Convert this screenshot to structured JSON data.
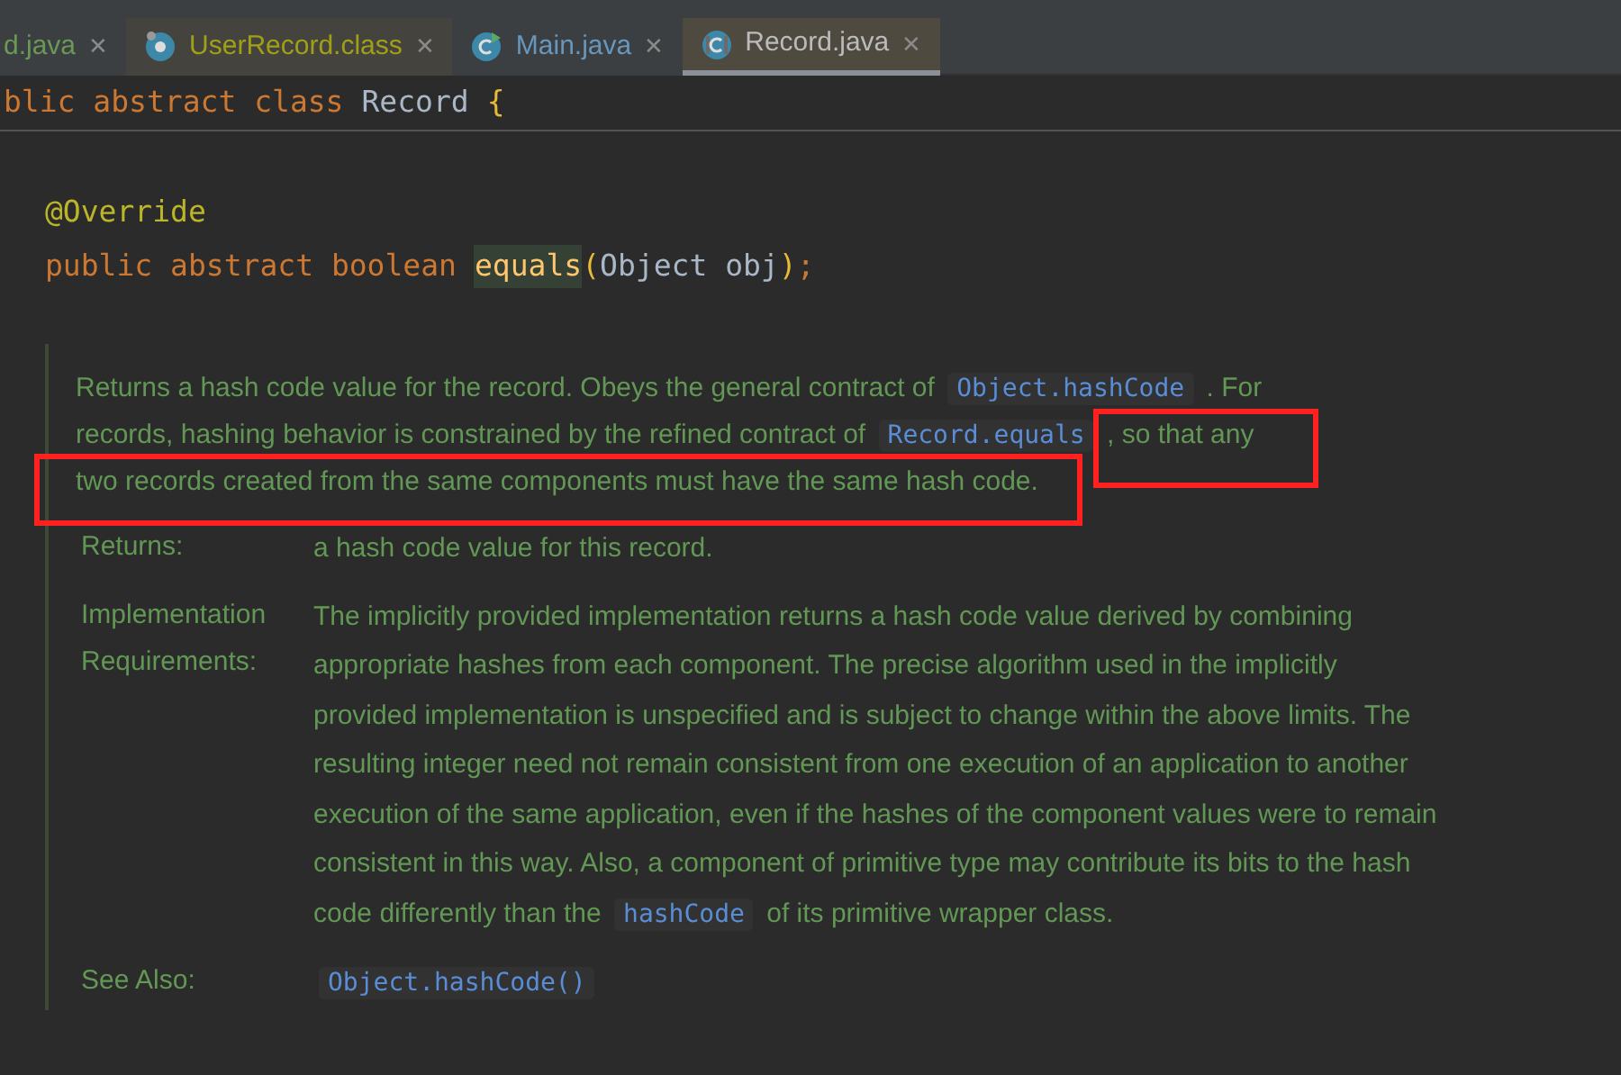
{
  "tabs": [
    {
      "label": "d.java",
      "kind": "plain",
      "close": "✕",
      "selected": false,
      "color": "#6a9955"
    },
    {
      "label": "UserRecord.class",
      "kind": "record",
      "close": "✕",
      "selected": false,
      "color": "#a0a018"
    },
    {
      "label": "Main.java",
      "kind": "runnable",
      "close": "✕",
      "selected": false,
      "color": "#6897bb"
    },
    {
      "label": "Record.java",
      "kind": "abstract",
      "close": "✕",
      "selected": true,
      "color": "#bbbbbb"
    }
  ],
  "sticky_header": [
    {
      "kind": "keyword",
      "text": "blic abstract class"
    },
    {
      "kind": "name",
      "text": "Record"
    },
    {
      "kind": "brace",
      "text": "{"
    }
  ],
  "code_lines": [
    [
      {
        "kind": "annotation",
        "text": "@Override"
      }
    ],
    [
      {
        "kind": "keyword",
        "text": "public abstract boolean"
      },
      {
        "kind": "method",
        "text": "equals"
      },
      {
        "kind": "paren",
        "text": "("
      },
      {
        "kind": "plain",
        "text": "Object obj"
      },
      {
        "kind": "paren",
        "text": ")"
      },
      {
        "kind": "keyword",
        "text": ";"
      }
    ]
  ],
  "doc": {
    "description": [
      {
        "kind": "text",
        "text": "Returns a hash code value for the record. Obeys the general contract of"
      },
      {
        "kind": "code",
        "text": "Object.hashCode"
      },
      {
        "kind": "text",
        "text": ". For records, hashing behavior is constrained by the refined contract of"
      },
      {
        "kind": "code",
        "text": "Record.equals"
      },
      {
        "kind": "text",
        "text": ", so that any two records created from the same components must have the same hash code."
      }
    ],
    "sections": [
      {
        "label": "Returns:",
        "value": [
          {
            "kind": "text",
            "text": "a hash code value for this record."
          }
        ]
      },
      {
        "label": "Implementation Requirements:",
        "value": [
          {
            "kind": "text",
            "text": "The implicitly provided implementation returns a hash code value derived by combining appropriate hashes from each component. The precise algorithm used in the implicitly provided implementation is unspecified and is subject to change within the above limits. The resulting integer need not remain consistent from one execution of an application to another execution of the same application, even if the hashes of the component values were to remain consistent in this way. Also, a component of primitive type may contribute its bits to the hash code differently than the"
          },
          {
            "kind": "code",
            "text": "hashCode"
          },
          {
            "kind": "text",
            "text": "of its primitive wrapper class."
          }
        ]
      },
      {
        "label": "See Also:",
        "value": [
          {
            "kind": "code",
            "text": "Object.hashCode()"
          }
        ]
      }
    ]
  },
  "annotations": [
    {
      "color": "#ff2020"
    },
    {
      "color": "#ff2020"
    }
  ]
}
